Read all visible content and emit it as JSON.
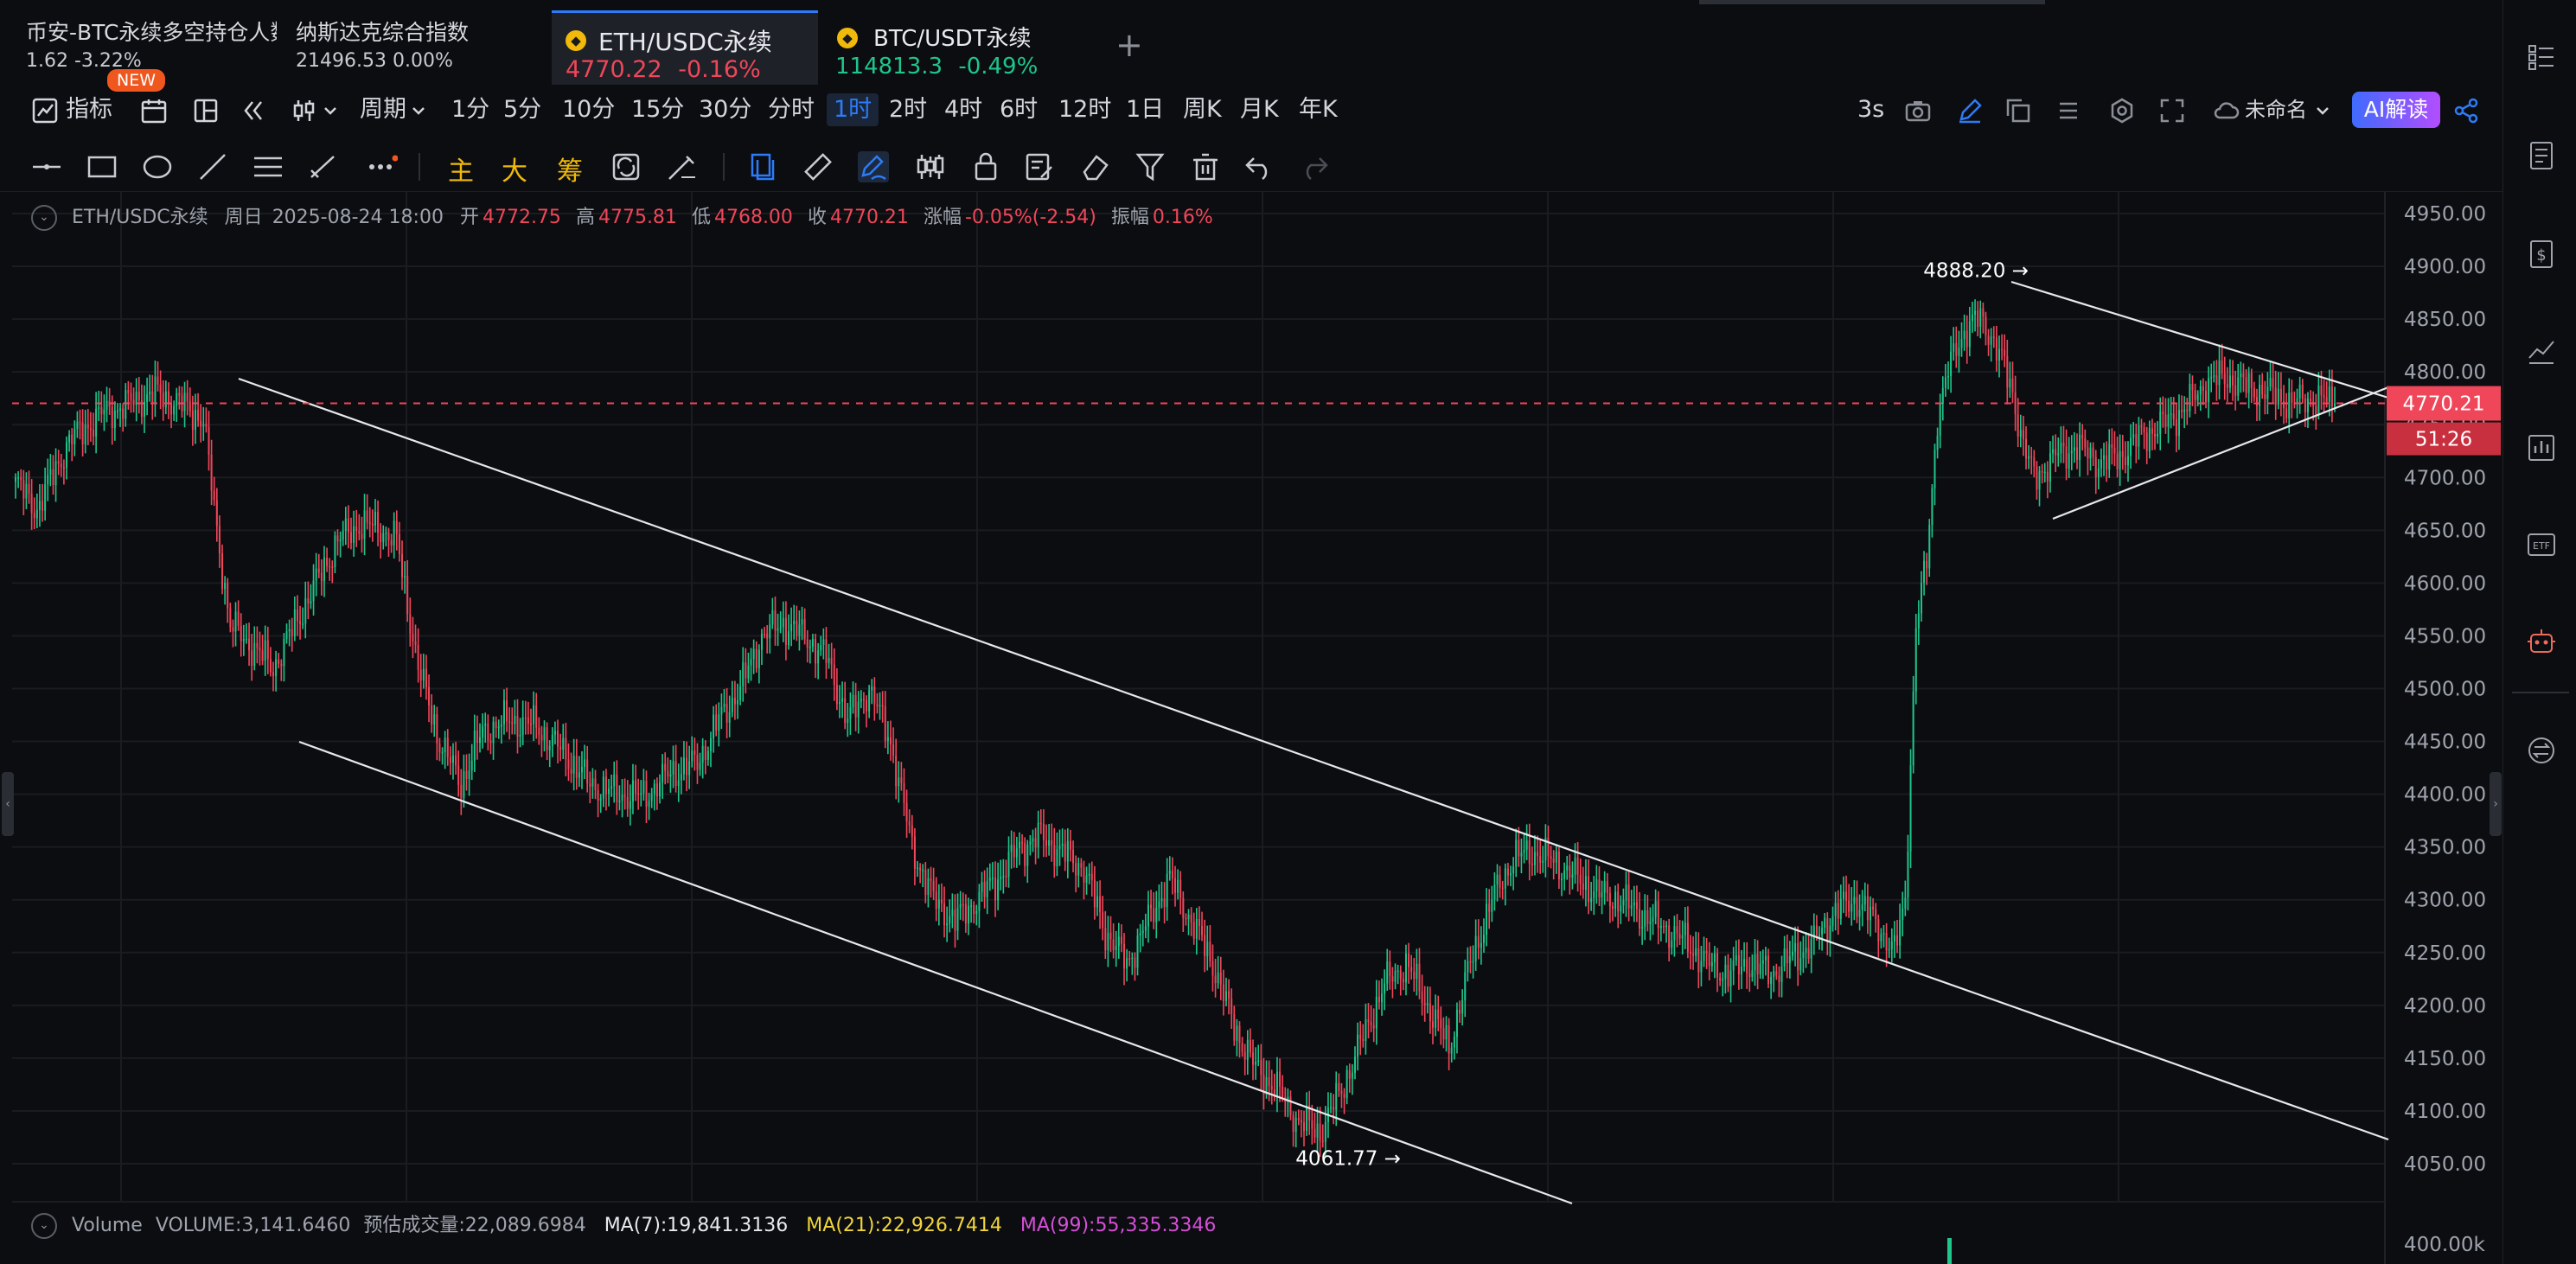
{
  "tickers": [
    {
      "name": "币安-BTC永续多空持仓人数比",
      "value": "1.62  -3.22%",
      "badge": "NEW"
    },
    {
      "name": "纳斯达克综合指数",
      "value": "21496.53  0.00%"
    }
  ],
  "tabs": [
    {
      "name": "ETH/USDC永续",
      "price": "4770.22",
      "change": "-0.16%",
      "direction": "down",
      "active": true
    },
    {
      "name": "BTC/USDT永续",
      "price": "114813.3",
      "change": "-0.49%",
      "direction": "down",
      "active": false
    }
  ],
  "add_tab": "+",
  "toolbar": {
    "indicators": "指标",
    "period": "周期",
    "intervals": [
      "1分",
      "5分",
      "10分",
      "15分",
      "30分",
      "分时",
      "1时",
      "2时",
      "4时",
      "6时",
      "12时",
      "1日",
      "周K",
      "月K",
      "年K"
    ],
    "selected_interval": "1时",
    "refresh": "3s",
    "layout_name": "未命名",
    "ai_button": "AI解读"
  },
  "drawing_tools": {
    "text_tools": [
      "主",
      "大",
      "筹"
    ],
    "icons": [
      "horizontal-line-icon",
      "rectangle-icon",
      "ellipse-icon",
      "trend-line-icon",
      "parallel-channel-icon",
      "ruler-icon",
      "more-icon",
      "magnet-icon",
      "measure-icon",
      "brush-icon",
      "pattern-icon",
      "lock-icon",
      "note-icon",
      "eraser-icon",
      "filter-icon",
      "trash-icon",
      "undo-icon",
      "redo-icon"
    ]
  },
  "ohlc_info": {
    "symbol": "ETH/USDC永续",
    "period_label": "周日",
    "datetime": "2025-08-24 18:00",
    "open_label": "开",
    "open": "4772.75",
    "high_label": "高",
    "high": "4775.81",
    "low_label": "低",
    "low": "4768.00",
    "close_label": "收",
    "close": "4770.21",
    "change_label": "涨幅",
    "change": "-0.05%(-2.54)",
    "amplitude_label": "振幅",
    "amplitude": "0.16%"
  },
  "volume_info": {
    "label": "Volume",
    "volume": "VOLUME:3,141.6460",
    "estimated": "预估成交量:22,089.6984",
    "ma7": "MA(7):19,841.3136",
    "ma21": "MA(21):22,926.7414",
    "ma99": "MA(99):55,335.3346",
    "axis_label": "400.00k"
  },
  "chart_data": {
    "type": "candlestick",
    "symbol": "ETH/USDC永续",
    "interval": "1时",
    "y_ticks": [
      "4950.00",
      "4900.00",
      "4850.00",
      "4800.00",
      "4750.00",
      "4700.00",
      "4650.00",
      "4600.00",
      "4550.00",
      "4500.00",
      "4450.00",
      "4400.00",
      "4350.00",
      "4300.00",
      "4250.00",
      "4200.00",
      "4150.00",
      "4100.00",
      "4050.00"
    ],
    "ylim": [
      4030,
      4968
    ],
    "last_price": "4770.21",
    "countdown": "51:26",
    "annotations": [
      {
        "label": "4888.20",
        "value": 4888.2
      },
      {
        "label": "4061.77",
        "value": 4061.77
      }
    ],
    "colors": {
      "up": "#1fc58b",
      "down": "#f0465a",
      "background": "#0c0d10",
      "price_line": "#f0465a"
    },
    "anchors": [
      [
        0,
        4695
      ],
      [
        8,
        4670
      ],
      [
        20,
        4735
      ],
      [
        32,
        4760
      ],
      [
        42,
        4770
      ],
      [
        52,
        4780
      ],
      [
        60,
        4772
      ],
      [
        70,
        4755
      ],
      [
        75,
        4650
      ],
      [
        80,
        4560
      ],
      [
        88,
        4540
      ],
      [
        96,
        4520
      ],
      [
        104,
        4560
      ],
      [
        112,
        4600
      ],
      [
        120,
        4640
      ],
      [
        128,
        4655
      ],
      [
        136,
        4652
      ],
      [
        142,
        4640
      ],
      [
        150,
        4520
      ],
      [
        158,
        4450
      ],
      [
        166,
        4410
      ],
      [
        174,
        4460
      ],
      [
        184,
        4470
      ],
      [
        194,
        4465
      ],
      [
        204,
        4440
      ],
      [
        214,
        4410
      ],
      [
        224,
        4400
      ],
      [
        234,
        4398
      ],
      [
        244,
        4420
      ],
      [
        254,
        4430
      ],
      [
        262,
        4470
      ],
      [
        270,
        4500
      ],
      [
        278,
        4550
      ],
      [
        286,
        4562
      ],
      [
        294,
        4550
      ],
      [
        302,
        4530
      ],
      [
        310,
        4470
      ],
      [
        318,
        4500
      ],
      [
        326,
        4450
      ],
      [
        334,
        4350
      ],
      [
        342,
        4300
      ],
      [
        350,
        4280
      ],
      [
        358,
        4300
      ],
      [
        366,
        4320
      ],
      [
        374,
        4350
      ],
      [
        382,
        4360
      ],
      [
        390,
        4345
      ],
      [
        398,
        4330
      ],
      [
        406,
        4270
      ],
      [
        414,
        4240
      ],
      [
        422,
        4280
      ],
      [
        430,
        4320
      ],
      [
        438,
        4280
      ],
      [
        446,
        4240
      ],
      [
        454,
        4180
      ],
      [
        462,
        4140
      ],
      [
        470,
        4120
      ],
      [
        478,
        4090
      ],
      [
        486,
        4080
      ],
      [
        494,
        4120
      ],
      [
        502,
        4170
      ],
      [
        510,
        4220
      ],
      [
        518,
        4240
      ],
      [
        526,
        4200
      ],
      [
        534,
        4160
      ],
      [
        542,
        4240
      ],
      [
        550,
        4300
      ],
      [
        558,
        4340
      ],
      [
        566,
        4345
      ],
      [
        574,
        4335
      ],
      [
        582,
        4320
      ],
      [
        590,
        4305
      ],
      [
        598,
        4300
      ],
      [
        606,
        4285
      ],
      [
        614,
        4275
      ],
      [
        622,
        4260
      ],
      [
        630,
        4240
      ],
      [
        638,
        4230
      ],
      [
        646,
        4240
      ],
      [
        654,
        4230
      ],
      [
        662,
        4245
      ],
      [
        670,
        4260
      ],
      [
        678,
        4290
      ],
      [
        686,
        4300
      ],
      [
        694,
        4275
      ],
      [
        700,
        4250
      ],
      [
        704,
        4300
      ],
      [
        708,
        4560
      ],
      [
        712,
        4620
      ],
      [
        716,
        4760
      ],
      [
        720,
        4800
      ],
      [
        724,
        4830
      ],
      [
        728,
        4845
      ],
      [
        732,
        4850
      ],
      [
        736,
        4835
      ],
      [
        740,
        4810
      ],
      [
        744,
        4780
      ],
      [
        748,
        4730
      ],
      [
        752,
        4700
      ],
      [
        760,
        4720
      ],
      [
        768,
        4730
      ],
      [
        776,
        4715
      ],
      [
        784,
        4720
      ],
      [
        792,
        4740
      ],
      [
        800,
        4750
      ],
      [
        808,
        4765
      ],
      [
        816,
        4790
      ],
      [
        824,
        4795
      ],
      [
        832,
        4785
      ],
      [
        840,
        4780
      ],
      [
        848,
        4770
      ],
      [
        856,
        4775
      ],
      [
        864,
        4770
      ]
    ]
  }
}
